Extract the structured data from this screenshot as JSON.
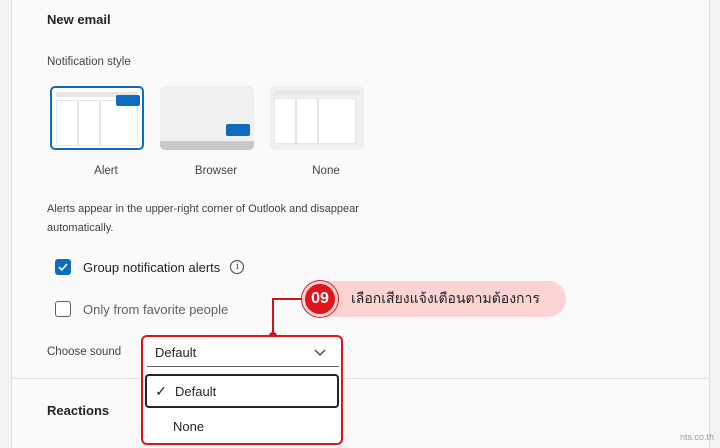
{
  "sections": {
    "new_email_title": "New email",
    "reactions_title": "Reactions"
  },
  "notification_style": {
    "label": "Notification style",
    "options": [
      {
        "label": "Alert",
        "selected": true
      },
      {
        "label": "Browser",
        "selected": false
      },
      {
        "label": "None",
        "selected": false
      }
    ],
    "description": "Alerts appear in the upper-right corner of Outlook and disappear automatically."
  },
  "checkboxes": {
    "group_alerts": {
      "label": "Group notification alerts",
      "checked": true
    },
    "favorites_only": {
      "label": "Only from favorite people",
      "checked": false
    }
  },
  "sound": {
    "label": "Choose sound",
    "value": "Default",
    "options": [
      "Default",
      "None"
    ]
  },
  "callout": {
    "number": "09",
    "text": "เลือกเสียงแจ้งเตือนตามต้องการ"
  },
  "watermark": "nts.co.th",
  "colors": {
    "accent": "#0f6cbd",
    "callout_red": "#e0141c",
    "callout_bg": "#fbd3d3"
  }
}
